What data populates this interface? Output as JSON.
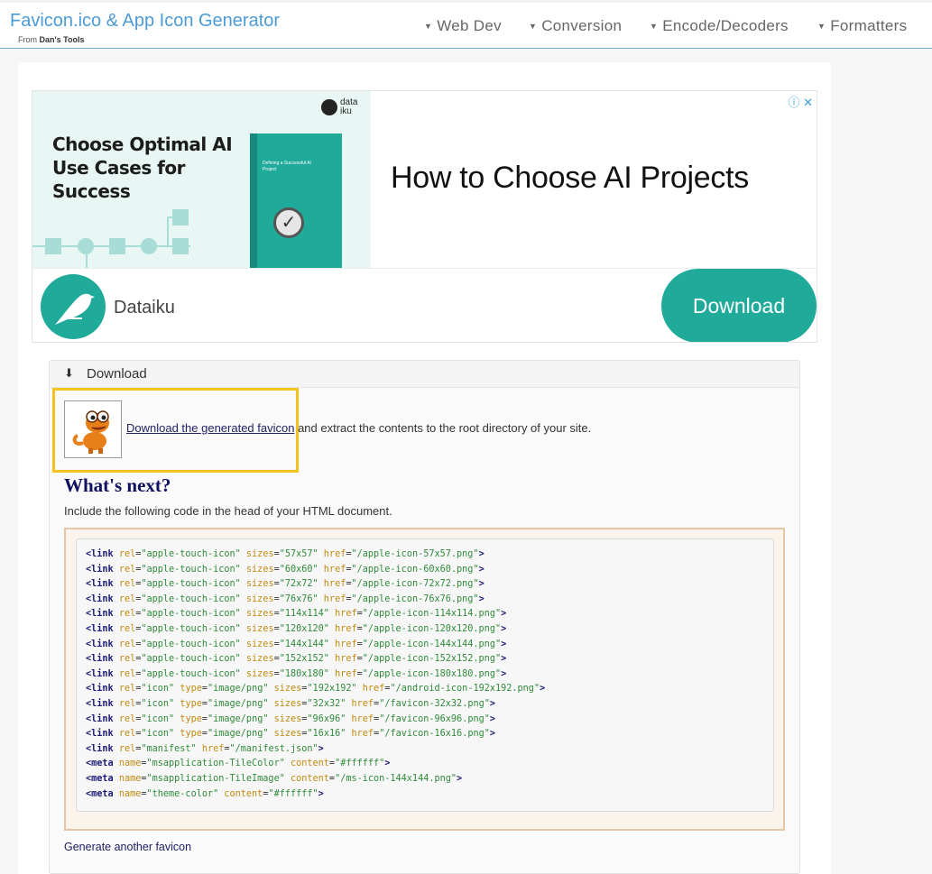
{
  "header": {
    "title": "Favicon.ico & App Icon Generator",
    "sub_prefix": "From",
    "sub_brand": "Dan's Tools",
    "nav": [
      {
        "label": "Web Dev"
      },
      {
        "label": "Conversion"
      },
      {
        "label": "Encode/Decoders"
      },
      {
        "label": "Formatters"
      }
    ]
  },
  "ad": {
    "left_headline": "Choose Optimal AI Use Cases for Success",
    "book_text": "Defining a Successful AI Project",
    "brand_mark": "data iku",
    "right_title": "How to Choose AI Projects",
    "advertiser": "Dataiku",
    "cta": "Download",
    "brand_color": "#1faa9a"
  },
  "panel": {
    "title": "Download",
    "icon": "download-icon",
    "download_link": "Download the generated favicon",
    "download_rest": " and extract the contents to the root directory of your site.",
    "whats_next": "What's next?",
    "include_text": "Include the following code in the head of your HTML document.",
    "another_link": "Generate another favicon",
    "highlight_color": "#f7c21e",
    "code_lines": [
      {
        "tag": "link",
        "attrs": [
          [
            "rel",
            "apple-touch-icon"
          ],
          [
            "sizes",
            "57x57"
          ],
          [
            "href",
            "/apple-icon-57x57.png"
          ]
        ]
      },
      {
        "tag": "link",
        "attrs": [
          [
            "rel",
            "apple-touch-icon"
          ],
          [
            "sizes",
            "60x60"
          ],
          [
            "href",
            "/apple-icon-60x60.png"
          ]
        ]
      },
      {
        "tag": "link",
        "attrs": [
          [
            "rel",
            "apple-touch-icon"
          ],
          [
            "sizes",
            "72x72"
          ],
          [
            "href",
            "/apple-icon-72x72.png"
          ]
        ]
      },
      {
        "tag": "link",
        "attrs": [
          [
            "rel",
            "apple-touch-icon"
          ],
          [
            "sizes",
            "76x76"
          ],
          [
            "href",
            "/apple-icon-76x76.png"
          ]
        ]
      },
      {
        "tag": "link",
        "attrs": [
          [
            "rel",
            "apple-touch-icon"
          ],
          [
            "sizes",
            "114x114"
          ],
          [
            "href",
            "/apple-icon-114x114.png"
          ]
        ]
      },
      {
        "tag": "link",
        "attrs": [
          [
            "rel",
            "apple-touch-icon"
          ],
          [
            "sizes",
            "120x120"
          ],
          [
            "href",
            "/apple-icon-120x120.png"
          ]
        ]
      },
      {
        "tag": "link",
        "attrs": [
          [
            "rel",
            "apple-touch-icon"
          ],
          [
            "sizes",
            "144x144"
          ],
          [
            "href",
            "/apple-icon-144x144.png"
          ]
        ]
      },
      {
        "tag": "link",
        "attrs": [
          [
            "rel",
            "apple-touch-icon"
          ],
          [
            "sizes",
            "152x152"
          ],
          [
            "href",
            "/apple-icon-152x152.png"
          ]
        ]
      },
      {
        "tag": "link",
        "attrs": [
          [
            "rel",
            "apple-touch-icon"
          ],
          [
            "sizes",
            "180x180"
          ],
          [
            "href",
            "/apple-icon-180x180.png"
          ]
        ]
      },
      {
        "tag": "link",
        "attrs": [
          [
            "rel",
            "icon"
          ],
          [
            "type",
            "image/png"
          ],
          [
            "sizes",
            "192x192"
          ],
          [
            "href",
            "/android-icon-192x192.png"
          ]
        ]
      },
      {
        "tag": "link",
        "attrs": [
          [
            "rel",
            "icon"
          ],
          [
            "type",
            "image/png"
          ],
          [
            "sizes",
            "32x32"
          ],
          [
            "href",
            "/favicon-32x32.png"
          ]
        ]
      },
      {
        "tag": "link",
        "attrs": [
          [
            "rel",
            "icon"
          ],
          [
            "type",
            "image/png"
          ],
          [
            "sizes",
            "96x96"
          ],
          [
            "href",
            "/favicon-96x96.png"
          ]
        ]
      },
      {
        "tag": "link",
        "attrs": [
          [
            "rel",
            "icon"
          ],
          [
            "type",
            "image/png"
          ],
          [
            "sizes",
            "16x16"
          ],
          [
            "href",
            "/favicon-16x16.png"
          ]
        ]
      },
      {
        "tag": "link",
        "attrs": [
          [
            "rel",
            "manifest"
          ],
          [
            "href",
            "/manifest.json"
          ]
        ]
      },
      {
        "tag": "meta",
        "attrs": [
          [
            "name",
            "msapplication-TileColor"
          ],
          [
            "content",
            "#ffffff"
          ]
        ]
      },
      {
        "tag": "meta",
        "attrs": [
          [
            "name",
            "msapplication-TileImage"
          ],
          [
            "content",
            "/ms-icon-144x144.png"
          ]
        ]
      },
      {
        "tag": "meta",
        "attrs": [
          [
            "name",
            "theme-color"
          ],
          [
            "content",
            "#ffffff"
          ]
        ]
      }
    ]
  }
}
